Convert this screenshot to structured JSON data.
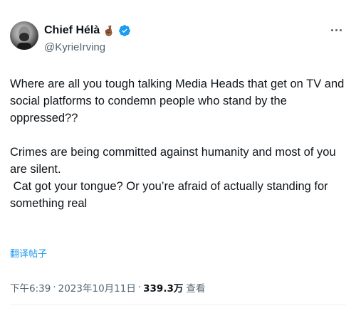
{
  "author": {
    "display_name": "Chief Hélà",
    "name_emoji": "🤞🏾",
    "handle": "@KyrieIrving",
    "verified": true
  },
  "tweet": {
    "paragraph_1": "Where are all you tough talking Media Heads that get on TV and social platforms to condemn people who stand by the oppressed??",
    "paragraph_2_line_1": "Crimes are being committed against humanity and most of you are silent.",
    "paragraph_2_line_2": " Cat got your tongue? Or you’re afraid of actually standing for something real"
  },
  "translate_label": "翻译帖子",
  "meta": {
    "time": "下午6:39",
    "separator": "·",
    "date": "2023年10月11日",
    "views_count": "339.3万",
    "views_label": "查看"
  },
  "colors": {
    "accent": "#1d9bf0",
    "text_primary": "#0f1419",
    "text_secondary": "#536471"
  },
  "icons": {
    "verified": "verified-badge-icon",
    "more": "more-dots-icon"
  }
}
